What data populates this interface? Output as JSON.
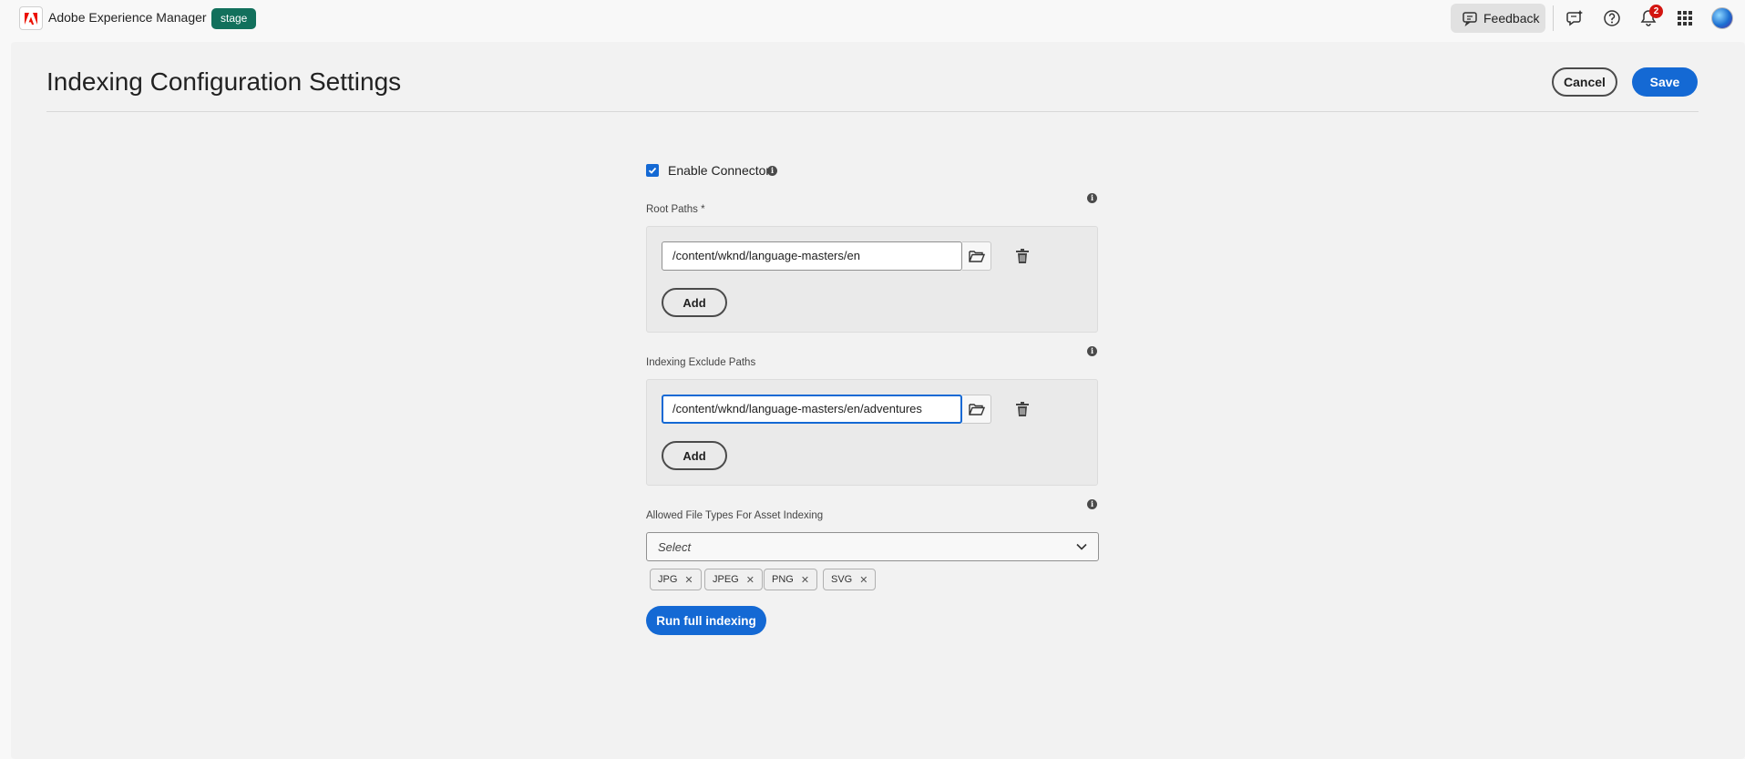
{
  "app": {
    "brand": "Adobe Experience Manager",
    "environment": "stage"
  },
  "topbar": {
    "feedback_label": "Feedback",
    "notification_count": "2",
    "icons": [
      "feedback-icon",
      "whats-new-icon",
      "help-icon",
      "bell-icon",
      "apps-grid-icon",
      "avatar"
    ]
  },
  "page": {
    "title": "Indexing Configuration Settings",
    "cancel_label": "Cancel",
    "save_label": "Save"
  },
  "form": {
    "enable_connector": {
      "label": "Enable Connector",
      "checked": true
    },
    "root_paths": {
      "label": "Root Paths *",
      "values": [
        "/content/wknd/language-masters/en"
      ],
      "add_label": "Add"
    },
    "exclude_paths": {
      "label": "Indexing Exclude Paths",
      "values": [
        "/content/wknd/language-masters/en/adventures"
      ],
      "add_label": "Add"
    },
    "file_types": {
      "label": "Allowed File Types For Asset Indexing",
      "placeholder": "Select",
      "tags": [
        "JPG",
        "JPEG",
        "PNG",
        "SVG"
      ]
    },
    "run_label": "Run full indexing"
  },
  "colors": {
    "accent": "#1469d4",
    "env_badge": "#12705c",
    "adobe_red": "#eb1000",
    "notification": "#d31510"
  }
}
